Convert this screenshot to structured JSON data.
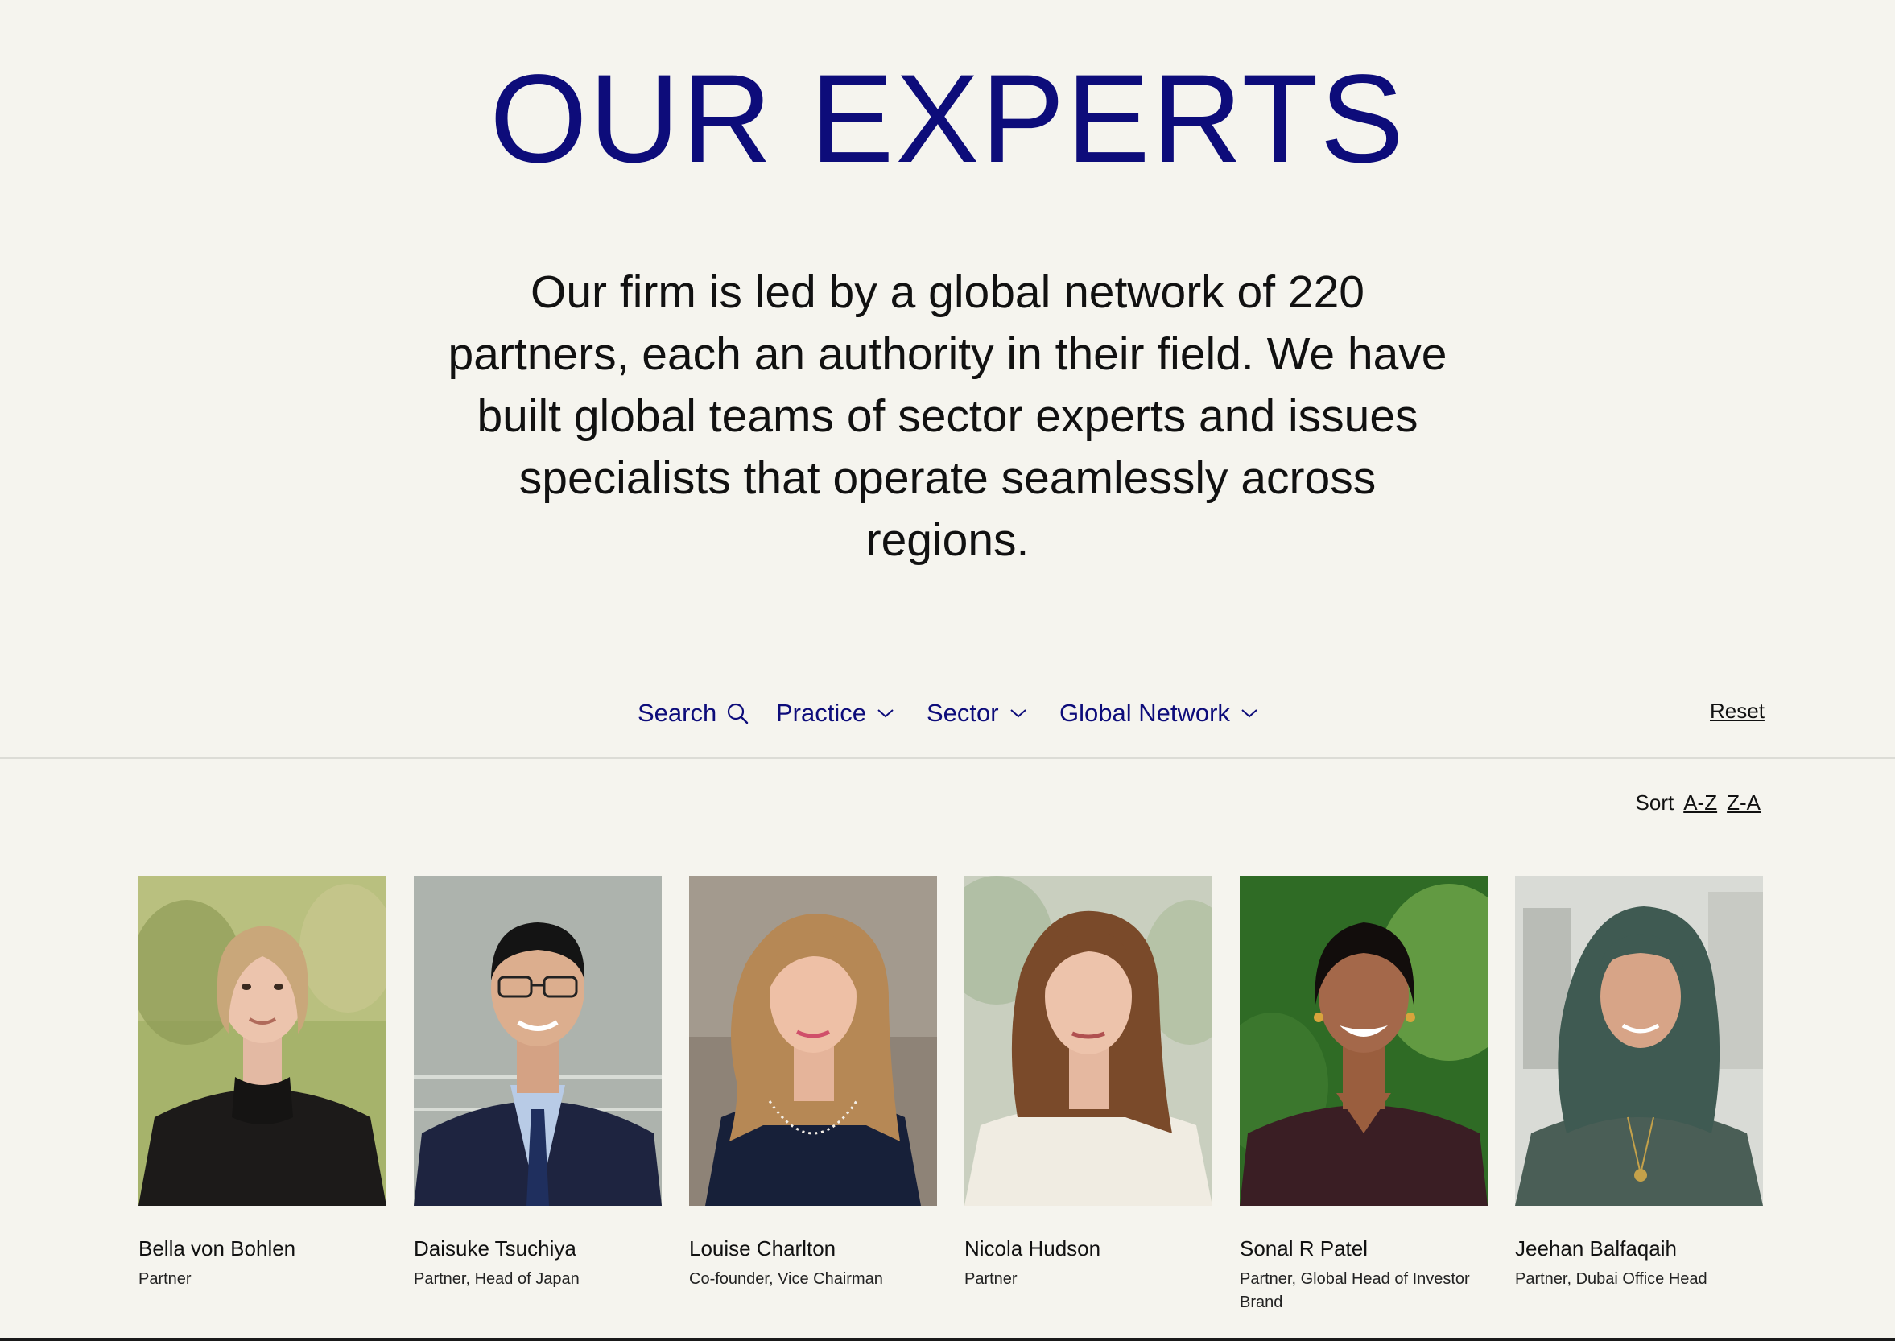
{
  "header": {
    "title": "OUR EXPERTS",
    "intro": "Our firm is led by a global network of 220 partners, each an authority in their field. We have built global teams of sector experts and issues specialists that operate seamlessly across regions."
  },
  "filters": {
    "search_label": "Search",
    "practice_label": "Practice",
    "sector_label": "Sector",
    "network_label": "Global Network",
    "reset_label": "Reset"
  },
  "sort": {
    "label": "Sort",
    "az_label": "A-Z",
    "za_label": "Z-A"
  },
  "experts": [
    {
      "name": "Bella von Bohlen",
      "role": "Partner"
    },
    {
      "name": "Daisuke Tsuchiya",
      "role": "Partner, Head of Japan"
    },
    {
      "name": "Louise Charlton",
      "role": "Co-founder, Vice Chairman"
    },
    {
      "name": "Nicola Hudson",
      "role": "Partner"
    },
    {
      "name": "Sonal R Patel",
      "role": "Partner, Global Head of Investor Brand"
    },
    {
      "name": "Jeehan Balfaqaih",
      "role": "Partner, Dubai Office Head"
    }
  ],
  "colors": {
    "accent": "#0d0c7a",
    "background": "#f5f4ee",
    "text": "#111111"
  },
  "icons": {
    "search": "search-icon",
    "dropdown": "chevron-down-icon"
  }
}
